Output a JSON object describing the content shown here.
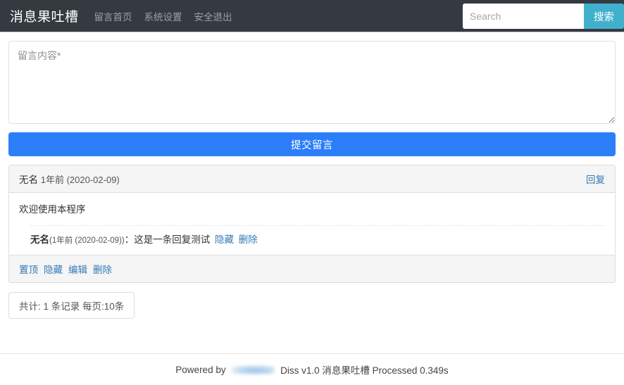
{
  "navbar": {
    "brand": "消息果吐槽",
    "links": [
      {
        "label": "留言首页",
        "name": "nav-link-home"
      },
      {
        "label": "系统设置",
        "name": "nav-link-settings"
      },
      {
        "label": "安全退出",
        "name": "nav-link-logout"
      }
    ],
    "search": {
      "value": "",
      "placeholder": "Search",
      "button_label": "搜索"
    }
  },
  "compose": {
    "textarea_value": "",
    "textarea_placeholder": "留言内容*",
    "submit_label": "提交留言"
  },
  "post": {
    "author": "无名",
    "meta": "1年前 (2020-02-09)",
    "reply_link": "回复",
    "body": "欢迎使用本程序",
    "replies": [
      {
        "author": "无名",
        "meta": "(1年前 (2020-02-09))",
        "separator": "：",
        "text": "这是一条回复测试",
        "actions": [
          {
            "label": "隐藏",
            "name": "reply-hide-link"
          },
          {
            "label": "删除",
            "name": "reply-delete-link"
          }
        ]
      }
    ],
    "footer_actions": [
      {
        "label": "置顶",
        "name": "post-top-link"
      },
      {
        "label": "隐藏",
        "name": "post-hide-link"
      },
      {
        "label": "编辑",
        "name": "post-edit-link"
      },
      {
        "label": "删除",
        "name": "post-delete-link"
      }
    ]
  },
  "pager": {
    "summary": "共计: 1 条记录 每页:10条"
  },
  "footer": {
    "prefix": "Powered by ",
    "suffix": " Diss v1.0 消息果吐槽 Processed 0.349s"
  },
  "colors": {
    "navbar_bg": "#343a40",
    "search_button": "#41b0cc",
    "submit_button": "#2c7ef8",
    "link": "#337ab7",
    "panel_bg": "#f5f5f5"
  }
}
